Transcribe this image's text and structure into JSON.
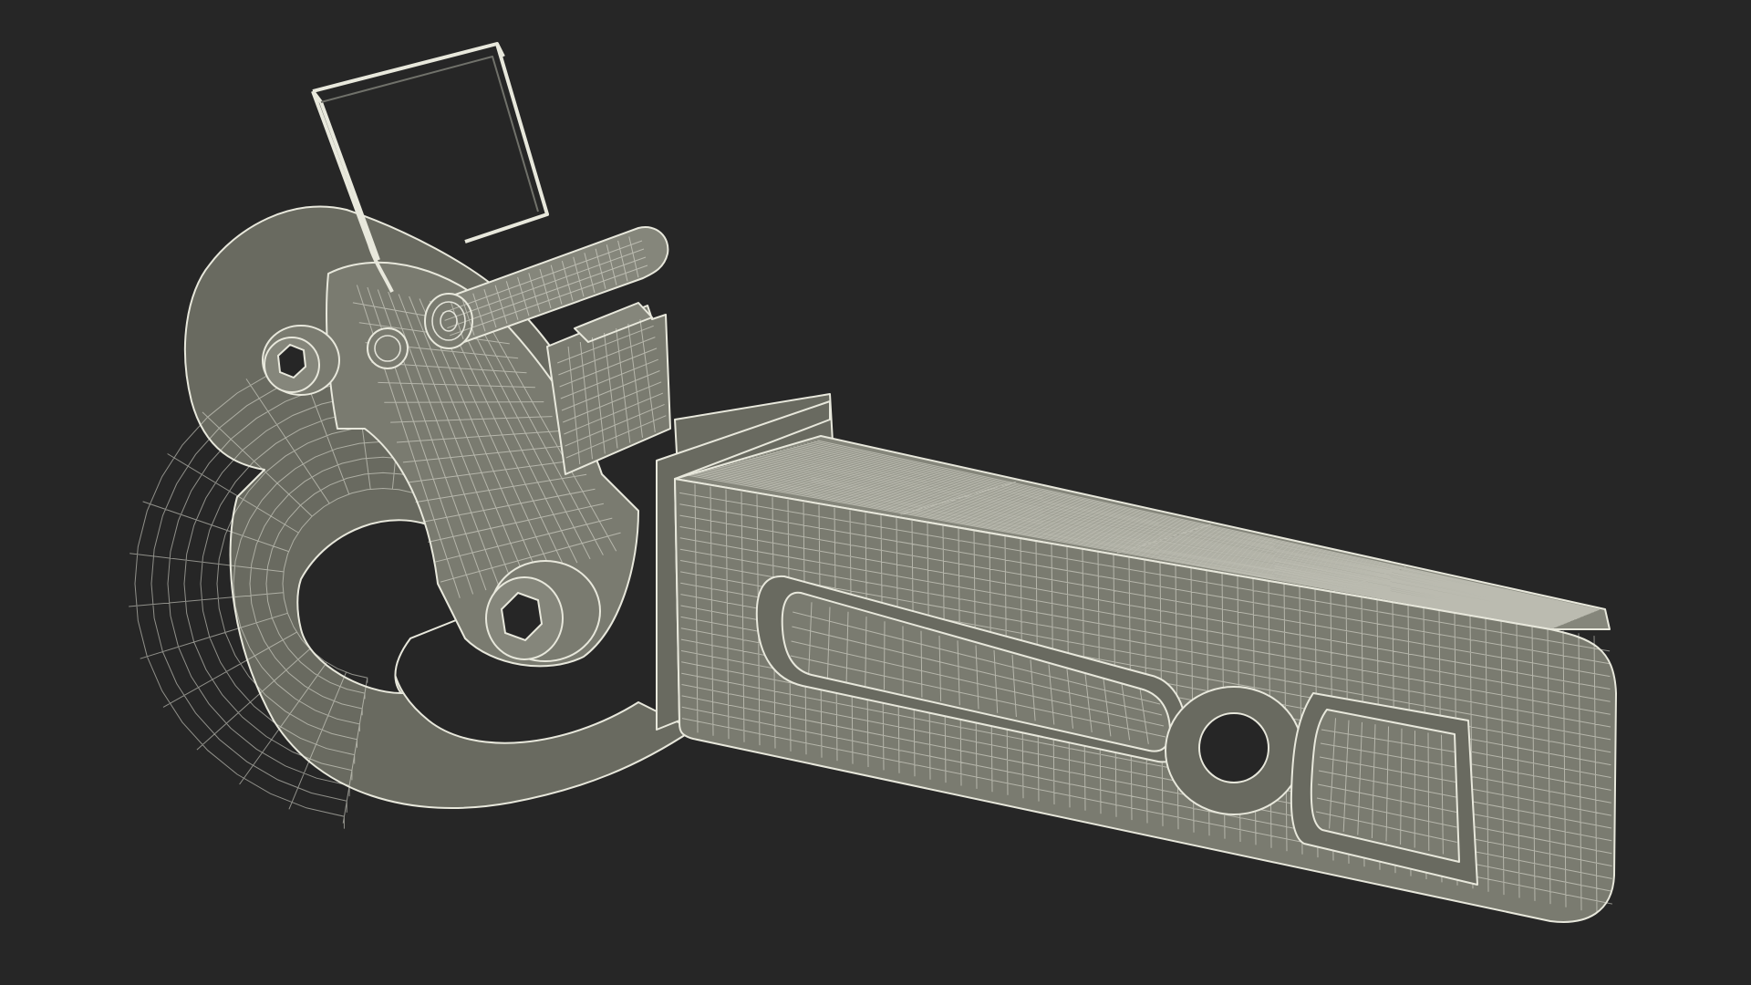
{
  "scene": {
    "background_color": "#262626",
    "mesh_color": "#7a7b70",
    "wire_color": "#e8e8dc"
  }
}
